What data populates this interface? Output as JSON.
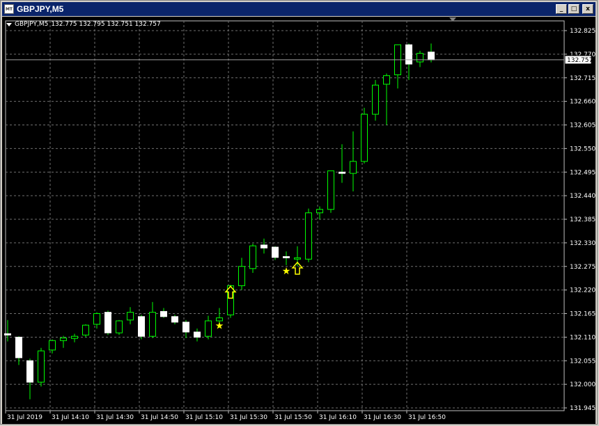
{
  "window": {
    "title": "GBPJPY,M5",
    "icon_label": "MT",
    "minimize": "_",
    "restore": "□",
    "close": "x"
  },
  "header": {
    "symbol": "GBPJPY,M5",
    "ohlc": "132.775 132.795 132.751 132.757"
  },
  "colors": {
    "background": "#000000",
    "grid": "#707070",
    "up_candle_outline": "#00ff00",
    "up_candle_fill": "#000000",
    "down_candle_fill": "#ffffff",
    "wick": "#00ff00",
    "signal": "#ffff00",
    "axis_text": "#ffffff"
  },
  "chart_data": {
    "type": "candlestick",
    "symbol": "GBPJPY",
    "timeframe": "M5",
    "price_ticks": [
      "132.825",
      "132.770",
      "132.715",
      "132.660",
      "132.605",
      "132.550",
      "132.495",
      "132.440",
      "132.385",
      "132.330",
      "132.275",
      "132.220",
      "132.165",
      "132.110",
      "132.055",
      "132.000",
      "131.945"
    ],
    "time_labels": [
      "31 Jul 2019",
      "31 Jul 14:10",
      "31 Jul 14:30",
      "31 Jul 14:50",
      "31 Jul 15:10",
      "31 Jul 15:30",
      "31 Jul 15:50",
      "31 Jul 16:10",
      "31 Jul 16:30",
      "31 Jul 16:50"
    ],
    "current_price": "132.757",
    "candles": [
      {
        "o": 132.118,
        "h": 132.15,
        "l": 132.1,
        "c": 132.115
      },
      {
        "o": 132.11,
        "h": 132.112,
        "l": 132.045,
        "c": 132.062
      },
      {
        "o": 132.055,
        "h": 132.06,
        "l": 131.965,
        "c": 132.005
      },
      {
        "o": 132.005,
        "h": 132.085,
        "l": 131.995,
        "c": 132.078
      },
      {
        "o": 132.08,
        "h": 132.105,
        "l": 132.072,
        "c": 132.102
      },
      {
        "o": 132.102,
        "h": 132.113,
        "l": 132.085,
        "c": 132.108
      },
      {
        "o": 132.107,
        "h": 132.118,
        "l": 132.098,
        "c": 132.112
      },
      {
        "o": 132.115,
        "h": 132.14,
        "l": 132.11,
        "c": 132.138
      },
      {
        "o": 132.14,
        "h": 132.168,
        "l": 132.13,
        "c": 132.165
      },
      {
        "o": 132.168,
        "h": 132.172,
        "l": 132.115,
        "c": 132.12
      },
      {
        "o": 132.12,
        "h": 132.15,
        "l": 132.115,
        "c": 132.148
      },
      {
        "o": 132.15,
        "h": 132.18,
        "l": 132.14,
        "c": 132.168
      },
      {
        "o": 132.158,
        "h": 132.162,
        "l": 132.105,
        "c": 132.112
      },
      {
        "o": 132.112,
        "h": 132.192,
        "l": 132.108,
        "c": 132.168
      },
      {
        "o": 132.17,
        "h": 132.178,
        "l": 132.155,
        "c": 132.158
      },
      {
        "o": 132.158,
        "h": 132.162,
        "l": 132.14,
        "c": 132.145
      },
      {
        "o": 132.145,
        "h": 132.15,
        "l": 132.108,
        "c": 132.122
      },
      {
        "o": 132.122,
        "h": 132.13,
        "l": 132.1,
        "c": 132.11
      },
      {
        "o": 132.112,
        "h": 132.16,
        "l": 132.105,
        "c": 132.148
      },
      {
        "o": 132.148,
        "h": 132.178,
        "l": 132.132,
        "c": 132.155
      },
      {
        "o": 132.162,
        "h": 132.232,
        "l": 132.155,
        "c": 132.23
      },
      {
        "o": 132.23,
        "h": 132.295,
        "l": 132.22,
        "c": 132.275
      },
      {
        "o": 132.27,
        "h": 132.328,
        "l": 132.26,
        "c": 132.323
      },
      {
        "o": 132.325,
        "h": 132.34,
        "l": 132.305,
        "c": 132.318
      },
      {
        "o": 132.32,
        "h": 132.322,
        "l": 132.29,
        "c": 132.296
      },
      {
        "o": 132.298,
        "h": 132.31,
        "l": 132.278,
        "c": 132.295
      },
      {
        "o": 132.292,
        "h": 132.322,
        "l": 132.275,
        "c": 132.295
      },
      {
        "o": 132.292,
        "h": 132.41,
        "l": 132.285,
        "c": 132.4
      },
      {
        "o": 132.4,
        "h": 132.415,
        "l": 132.385,
        "c": 132.408
      },
      {
        "o": 132.408,
        "h": 132.495,
        "l": 132.4,
        "c": 132.498
      },
      {
        "o": 132.495,
        "h": 132.56,
        "l": 132.47,
        "c": 132.492
      },
      {
        "o": 132.492,
        "h": 132.59,
        "l": 132.45,
        "c": 132.52
      },
      {
        "o": 132.52,
        "h": 132.645,
        "l": 132.515,
        "c": 132.63
      },
      {
        "o": 132.63,
        "h": 132.71,
        "l": 132.615,
        "c": 132.698
      },
      {
        "o": 132.7,
        "h": 132.725,
        "l": 132.605,
        "c": 132.72
      },
      {
        "o": 132.722,
        "h": 132.79,
        "l": 132.69,
        "c": 132.792
      },
      {
        "o": 132.792,
        "h": 132.795,
        "l": 132.71,
        "c": 132.747
      },
      {
        "o": 132.752,
        "h": 132.778,
        "l": 132.74,
        "c": 132.772
      },
      {
        "o": 132.775,
        "h": 132.795,
        "l": 132.751,
        "c": 132.757
      }
    ],
    "signals": [
      {
        "type": "star",
        "candle": 19,
        "price": 132.137
      },
      {
        "type": "up-arrow",
        "candle": 20,
        "price": 132.214
      },
      {
        "type": "star",
        "candle": 25,
        "price": 132.265
      },
      {
        "type": "up-arrow",
        "candle": 26,
        "price": 132.27
      }
    ]
  }
}
